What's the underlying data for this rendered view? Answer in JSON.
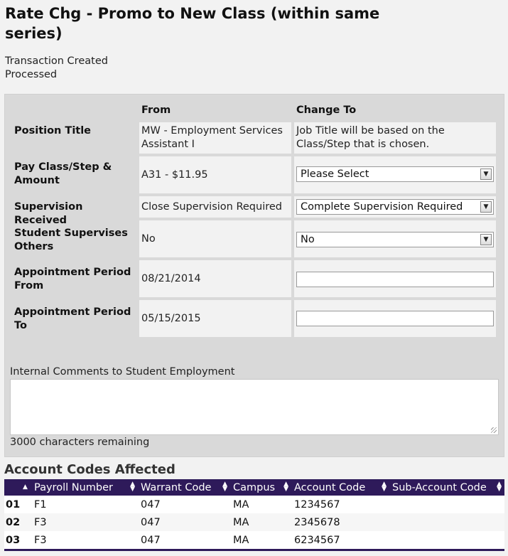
{
  "page": {
    "title": "Rate Chg - Promo to New Class (within same series)",
    "status_lines": [
      "Transaction Created",
      "Processed"
    ]
  },
  "form": {
    "from_header": "From",
    "change_to_header": "Change To",
    "rows": [
      {
        "label": "Position Title",
        "from": "MW - Employment Services Assistant I",
        "change_to": "Job Title will be based on the Class/Step that is chosen."
      },
      {
        "label": "Pay Class/Step & Amount",
        "from": "A31 - $11.95",
        "change_to": "Please Select"
      },
      {
        "label": "Supervision Received",
        "from": "Close Supervision Required",
        "change_to": "Complete Supervision Required"
      },
      {
        "label": "Student Supervises Others",
        "from": "No",
        "change_to": "No"
      },
      {
        "label": "Appointment Period From",
        "from": "08/21/2014",
        "change_to": ""
      },
      {
        "label": "Appointment Period To",
        "from": "05/15/2015",
        "change_to": ""
      }
    ],
    "comments_label": "Internal Comments to Student Employment",
    "comments_value": "",
    "chars_remaining": "3000 characters remaining"
  },
  "accounts": {
    "title": "Account Codes Affected",
    "columns": [
      "",
      "Payroll Number",
      "Warrant Code",
      "Campus",
      "Account Code",
      "Sub-Account Code"
    ],
    "rows": [
      {
        "num": "01",
        "payroll": "F1",
        "warrant": "047",
        "campus": "MA",
        "account": "1234567",
        "sub_account": ""
      },
      {
        "num": "02",
        "payroll": "F3",
        "warrant": "047",
        "campus": "MA",
        "account": "2345678",
        "sub_account": ""
      },
      {
        "num": "03",
        "payroll": "F3",
        "warrant": "047",
        "campus": "MA",
        "account": "6234567",
        "sub_account": ""
      }
    ]
  },
  "colors": {
    "header_bg": "#2e1a5a",
    "panel_bg": "#d9d9d9",
    "page_bg": "#f2f2f2"
  },
  "icons": {
    "dropdown": "triangle-down-icon",
    "sort": "sort-updown-icon",
    "resize": "resize-grip-icon"
  }
}
